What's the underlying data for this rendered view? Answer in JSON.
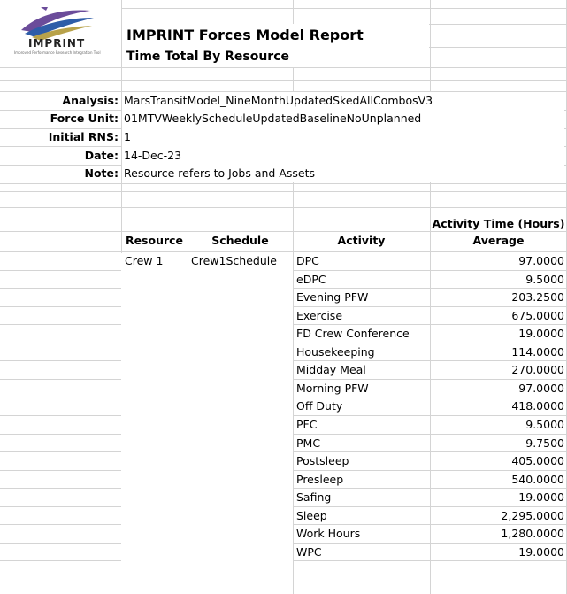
{
  "report": {
    "logo_text": "IMPRINT",
    "logo_tagline": "Improved Performance Research Integration Tool",
    "title": "IMPRINT Forces Model Report",
    "subtitle": "Time Total By Resource"
  },
  "meta": [
    {
      "label": "Analysis:",
      "value": "MarsTransitModel_NineMonthUpdatedSkedAllCombosV3"
    },
    {
      "label": "Force Unit:",
      "value": "01MTVWeeklyScheduleUpdatedBaselineNoUnplanned"
    },
    {
      "label": "Initial RNS:",
      "value": "1"
    },
    {
      "label": "Date:",
      "value": "14-Dec-23"
    },
    {
      "label": "Note:",
      "value": "Resource refers to Jobs and Assets"
    }
  ],
  "table": {
    "group_header": "Activity Time (Hours)",
    "headers": {
      "resource": "Resource",
      "schedule": "Schedule",
      "activity": "Activity",
      "average": "Average"
    },
    "resource": "Crew 1",
    "schedule": "Crew1Schedule",
    "rows": [
      {
        "activity": "DPC",
        "average": "97.0000"
      },
      {
        "activity": "eDPC",
        "average": "9.5000"
      },
      {
        "activity": "Evening PFW",
        "average": "203.2500"
      },
      {
        "activity": "Exercise",
        "average": "675.0000"
      },
      {
        "activity": "FD Crew Conference",
        "average": "19.0000"
      },
      {
        "activity": "Housekeeping",
        "average": "114.0000"
      },
      {
        "activity": "Midday Meal",
        "average": "270.0000"
      },
      {
        "activity": "Morning PFW",
        "average": "97.0000"
      },
      {
        "activity": "Off Duty",
        "average": "418.0000"
      },
      {
        "activity": "PFC",
        "average": "9.5000"
      },
      {
        "activity": "PMC",
        "average": "9.7500"
      },
      {
        "activity": "Postsleep",
        "average": "405.0000"
      },
      {
        "activity": "Presleep",
        "average": "540.0000"
      },
      {
        "activity": "Safing",
        "average": "19.0000"
      },
      {
        "activity": "Sleep",
        "average": "2,295.0000"
      },
      {
        "activity": "Work Hours",
        "average": "1,280.0000"
      },
      {
        "activity": "WPC",
        "average": "19.0000"
      }
    ]
  },
  "colors": {
    "gridline": "#d4d4d4",
    "logo_purple": "#6b4c9a",
    "logo_blue": "#2e5da8",
    "logo_gold": "#b8a24a"
  }
}
